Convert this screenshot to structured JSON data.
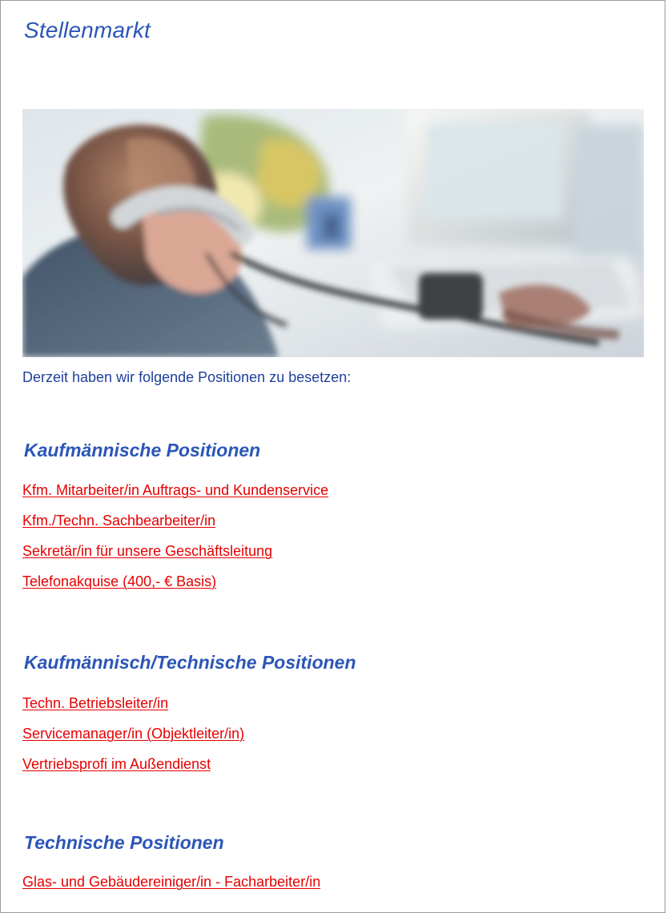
{
  "page": {
    "title": "Stellenmarkt",
    "intro": "Derzeit haben wir folgende Positionen zu besetzen:",
    "colors": {
      "title_blue": "#2b56b8",
      "text_blue": "#1f3f9c",
      "link_red": "#e50000"
    }
  },
  "hero": {
    "image": "office-phone-call-photo"
  },
  "sections": [
    {
      "heading": "Kaufmännische Positionen",
      "jobs": [
        "Kfm. Mitarbeiter/in Auftrags- und Kundenservice",
        "Kfm./Techn. Sachbearbeiter/in",
        "Sekretär/in für unsere Geschäftsleitung",
        "Telefonakquise (400,- € Basis)"
      ]
    },
    {
      "heading": "Kaufmännisch/Technische Positionen",
      "jobs": [
        "Techn. Betriebsleiter/in",
        "Servicemanager/in (Objektleiter/in)",
        "Vertriebsprofi im Außendienst"
      ]
    },
    {
      "heading": "Technische Positionen",
      "jobs": [
        "Glas- und Gebäudereiniger/in - Facharbeiter/in"
      ]
    }
  ]
}
